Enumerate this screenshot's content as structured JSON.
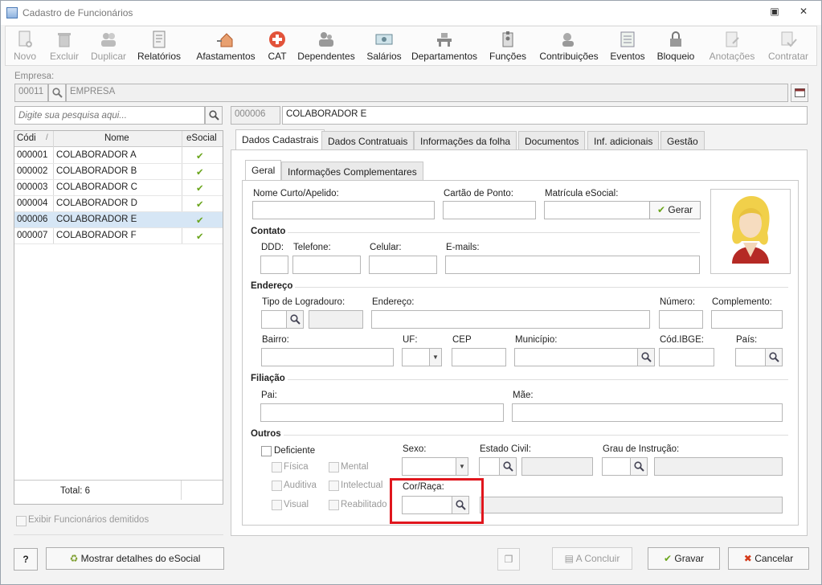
{
  "window": {
    "title": "Cadastro de Funcionários"
  },
  "toolbar": {
    "novo": "Novo",
    "excluir": "Excluir",
    "duplicar": "Duplicar",
    "relatorios": "Relatórios",
    "afastamentos": "Afastamentos",
    "cat": "CAT",
    "dependentes": "Dependentes",
    "salarios": "Salários",
    "departamentos": "Departamentos",
    "funcoes": "Funções",
    "contribuicoes": "Contribuições",
    "eventos": "Eventos",
    "bloqueio": "Bloqueio",
    "anotacoes": "Anotações",
    "contratar": "Contratar"
  },
  "empresa": {
    "label": "Empresa:",
    "code": "00011",
    "name": "EMPRESA"
  },
  "search": {
    "placeholder": "Digite sua pesquisa aqui..."
  },
  "employee": {
    "code": "000006",
    "name": "COLABORADOR E"
  },
  "grid": {
    "headers": {
      "code": "Códi",
      "name": "Nome",
      "esocial": "eSocial"
    },
    "rows": [
      {
        "code": "000001",
        "name": "COLABORADOR A"
      },
      {
        "code": "000002",
        "name": "COLABORADOR B"
      },
      {
        "code": "000003",
        "name": "COLABORADOR C"
      },
      {
        "code": "000004",
        "name": "COLABORADOR D"
      },
      {
        "code": "000006",
        "name": "COLABORADOR E"
      },
      {
        "code": "000007",
        "name": "COLABORADOR F"
      }
    ],
    "selected_index": 4,
    "total": "Total: 6"
  },
  "show_dismissed": "Exibir Funcionários demitidos",
  "tabs": {
    "main": [
      "Dados Cadastrais",
      "Dados Contratuais",
      "Informações da folha",
      "Documentos",
      "Inf. adicionais",
      "Gestão"
    ],
    "sub": [
      "Geral",
      "Informações Complementares"
    ]
  },
  "form": {
    "nome_curto": "Nome Curto/Apelido:",
    "cartao_ponto": "Cartão de Ponto:",
    "matricula": "Matrícula eSocial:",
    "gerar": "Gerar",
    "contato": "Contato",
    "ddd": "DDD:",
    "telefone": "Telefone:",
    "celular": "Celular:",
    "emails": "E-mails:",
    "endereco_section": "Endereço",
    "tipo_logradouro": "Tipo de Logradouro:",
    "endereco": "Endereço:",
    "numero": "Número:",
    "complemento": "Complemento:",
    "bairro": "Bairro:",
    "uf": "UF:",
    "cep": "CEP",
    "municipio": "Município:",
    "cod_ibge": "Cód.IBGE:",
    "pais": "País:",
    "filiacao": "Filiação",
    "pai": "Pai:",
    "mae": "Mãe:",
    "outros": "Outros",
    "deficiente": "Deficiente",
    "fisica": "Física",
    "mental": "Mental",
    "auditiva": "Auditiva",
    "intelectual": "Intelectual",
    "visual": "Visual",
    "reabilitado": "Reabilitado",
    "sexo": "Sexo:",
    "estado_civil": "Estado Civil:",
    "grau_instrucao": "Grau de Instrução:",
    "cor_raca": "Cor/Raça:"
  },
  "footer": {
    "help": "?",
    "esocial_details": "Mostrar detalhes do eSocial",
    "concluir": "A Concluir",
    "gravar": "Gravar",
    "cancelar": "Cancelar"
  },
  "colors": {
    "highlight": "#e0161d",
    "selected_row": "#d6e6f5",
    "check_green": "#6aa51c"
  }
}
